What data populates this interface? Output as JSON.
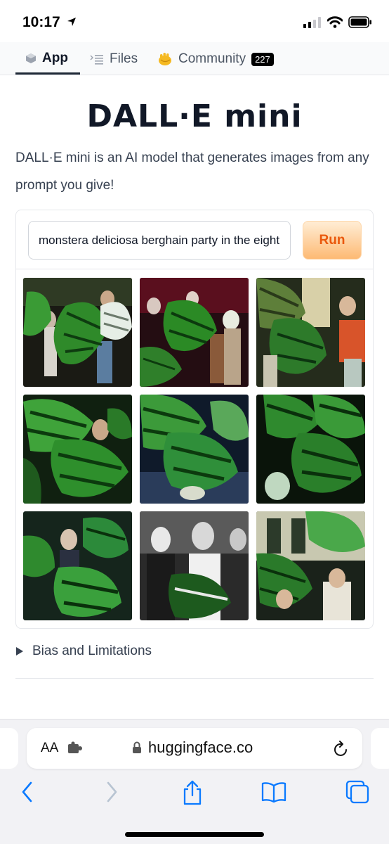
{
  "status": {
    "time": "10:17"
  },
  "tabs": [
    {
      "label": "App",
      "icon": "cube-icon",
      "active": true
    },
    {
      "label": "Files",
      "icon": "files-icon",
      "active": false
    },
    {
      "label": "Community",
      "icon": "hand-icon",
      "badge": "227",
      "active": false
    }
  ],
  "main": {
    "title": "DALL·E mini",
    "description": "DALL·E mini is an AI model that generates images from any prompt you give!",
    "prompt_value": "monstera deliciosa berghain party in the eighties",
    "run_label": "Run",
    "details_label": "Bias and Limitations"
  },
  "browser": {
    "aa_label": "AA",
    "url": "huggingface.co"
  },
  "colors": {
    "accent": "#ea580c",
    "run_bg": "#fdba74",
    "ios_blue": "#0a7aff",
    "leaf_green": "#2f9a3a"
  }
}
